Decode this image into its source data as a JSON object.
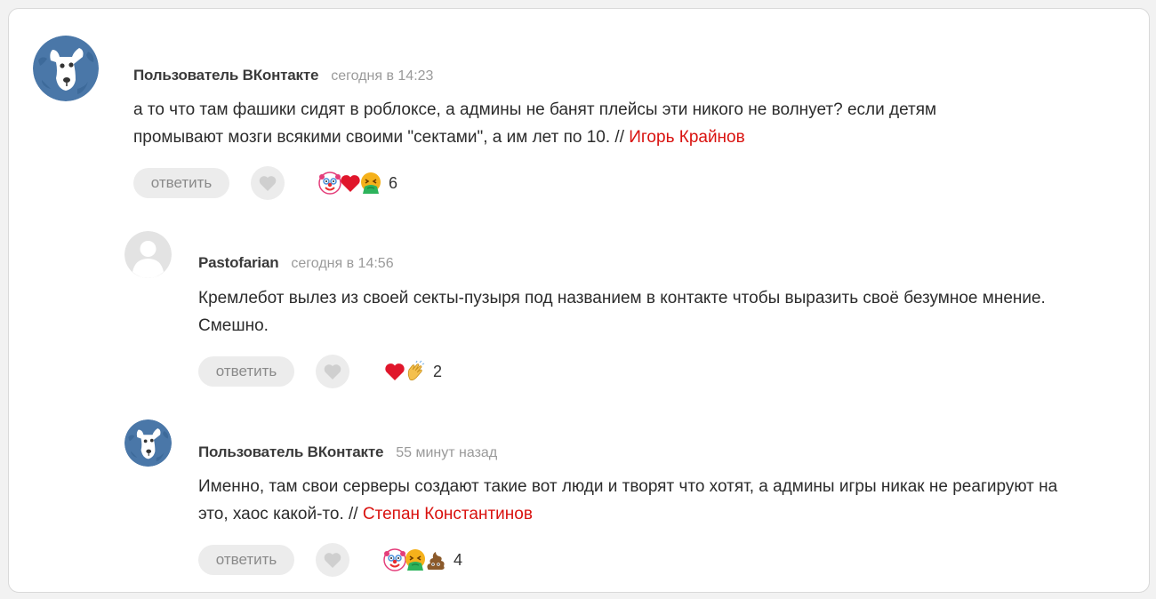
{
  "comments": [
    {
      "author": "Пользователь ВКонтакте",
      "time": "сегодня в 14:23",
      "avatar": "vk-dog-avatar",
      "text": "а то что там фашики сидят в роблоксе, а админы не банят плейсы эти никого не волнует? если детям промывают мозги всякими своими \"сектами\", а им лет по 10. // ",
      "mention": "Игорь Крайнов",
      "reply_label": "ответить",
      "reactions": [
        "clown-emoji",
        "heart-emoji",
        "vomit-emoji"
      ],
      "reaction_count": "6"
    },
    {
      "author": "Pastofarian",
      "time": "сегодня в 14:56",
      "avatar": "default-user-avatar",
      "text": "Кремлебот вылез из своей секты-пузыря под названием в контакте чтобы выразить своё безумное мнение. Смешно.",
      "mention": "",
      "reply_label": "ответить",
      "reactions": [
        "heart-emoji",
        "clap-emoji"
      ],
      "reaction_count": "2"
    },
    {
      "author": "Пользователь ВКонтакте",
      "time": "55 минут назад",
      "avatar": "vk-dog-avatar",
      "text": "Именно, там свои серверы создают такие вот люди и творят что хотят, а админы игры никак не реагируют на это, хаос какой-то. // ",
      "mention": "Степан Константинов",
      "reply_label": "ответить",
      "reactions": [
        "clown-emoji",
        "vomit-emoji",
        "poop-emoji"
      ],
      "reaction_count": "4"
    }
  ],
  "colors": {
    "mention": "#d9120f",
    "avatar_blue": "#4a77a8",
    "button_bg": "#ececec"
  }
}
